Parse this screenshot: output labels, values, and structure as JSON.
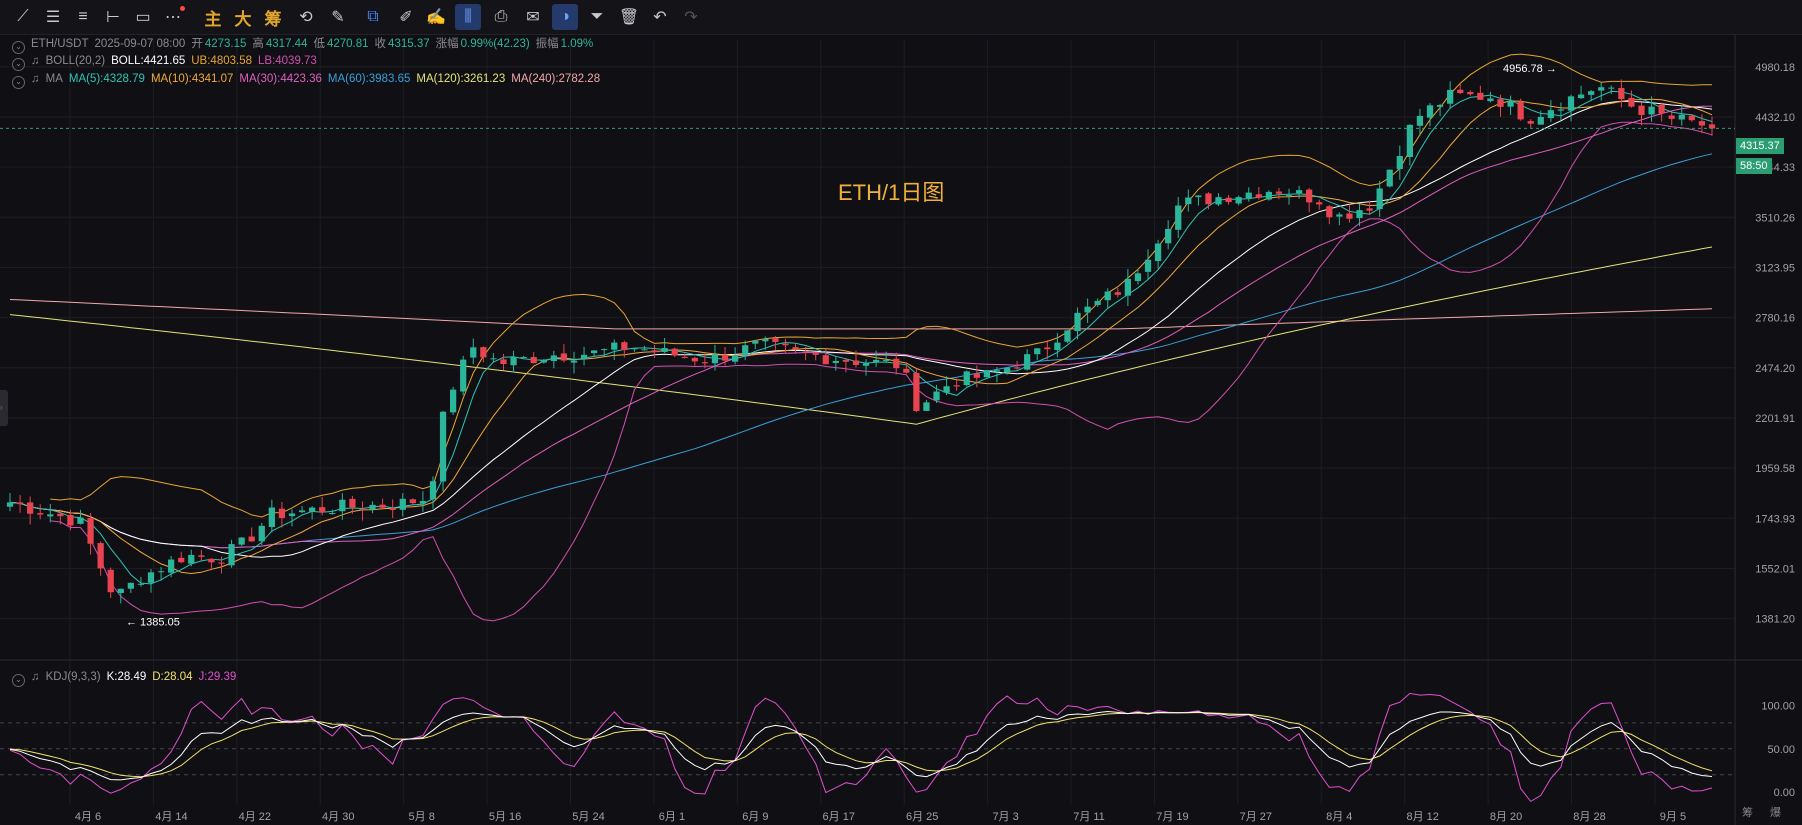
{
  "toolbar": {
    "tools": [
      {
        "name": "trendline-icon",
        "glyph": "⟋"
      },
      {
        "name": "horizontal-lines-icon",
        "glyph": "☰"
      },
      {
        "name": "parallel-lines-icon",
        "glyph": "≡"
      },
      {
        "name": "horizontal-ray-icon",
        "glyph": "⊢"
      },
      {
        "name": "rectangle-icon",
        "glyph": "▭"
      },
      {
        "name": "more-icon",
        "glyph": "⋯"
      },
      {
        "name": "main-chart-toggle",
        "glyph": "主",
        "cn": true
      },
      {
        "name": "large-toggle",
        "glyph": "大",
        "cn": true
      },
      {
        "name": "chips-toggle",
        "glyph": "筹",
        "cn": true
      },
      {
        "name": "strategy-icon",
        "glyph": "⟲"
      },
      {
        "name": "draw-settings-icon",
        "glyph": "✎"
      },
      {
        "name": "copy-icon",
        "glyph": "⧉",
        "active": true
      },
      {
        "name": "ruler-icon",
        "glyph": "✐"
      },
      {
        "name": "pen-icon",
        "glyph": "✍"
      },
      {
        "name": "compare-icon",
        "glyph": "⫼",
        "selected": true
      },
      {
        "name": "lock-icon",
        "glyph": "⎙"
      },
      {
        "name": "note-icon",
        "glyph": "✉"
      },
      {
        "name": "magnet-icon",
        "glyph": "◑",
        "selected": true
      },
      {
        "name": "filter-icon",
        "glyph": "⏷"
      },
      {
        "name": "delete-icon",
        "glyph": "🗑"
      },
      {
        "name": "undo-icon",
        "glyph": "↶"
      },
      {
        "name": "redo-icon",
        "glyph": "↷",
        "dim": true
      }
    ]
  },
  "ohlc": {
    "symbol": "ETH/USDT",
    "date": "2025-09-07 08:00",
    "open_label": "开",
    "open": "4273.15",
    "high_label": "高",
    "high": "4317.44",
    "low_label": "低",
    "low": "4270.81",
    "close_label": "收",
    "close": "4315.37",
    "change_label": "涨幅",
    "change": "0.99%(42.23)",
    "amp_label": "振幅",
    "amp": "1.09%"
  },
  "boll": {
    "name": "BOLL(20,2)",
    "mid": "BOLL:4421.65",
    "ub": "UB:4803.58",
    "lb": "LB:4039.73"
  },
  "ma": {
    "name": "MA",
    "ma5": "MA(5):4328.79",
    "ma10": "MA(10):4341.07",
    "ma30": "MA(30):4423.36",
    "ma60": "MA(60):3983.65",
    "ma120": "MA(120):3261.23",
    "ma240": "MA(240):2782.28"
  },
  "kdj": {
    "name": "KDJ(9,3,3)",
    "k": "K:28.49",
    "d": "D:28.04",
    "j": "J:29.39"
  },
  "watermark": "ETH/1日图",
  "current_price": "4315.37",
  "countdown": "58:50",
  "high_marker": "4956.78",
  "low_marker": "1385.05",
  "corner_labels": [
    "筹",
    "爆"
  ],
  "colors": {
    "up": "#2bb59a",
    "down": "#e8444f",
    "ma5": "#2ec4b6",
    "ma10": "#f0a93a",
    "ma30": "#e05fc0",
    "ma60": "#3a9fd8",
    "ma120": "#e3e37a",
    "ma240": "#f2a8a8",
    "boll_mid": "#ffffff",
    "boll_band": "#e8a530",
    "boll_lb": "#d04fb0",
    "kdj_k": "#ffffff",
    "kdj_d": "#f2e26a",
    "kdj_j": "#e04fd0"
  },
  "chart_data": {
    "type": "candlestick",
    "title": "ETH/1日图",
    "x_ticks": [
      "4月 6",
      "4月 14",
      "4月 22",
      "4月 30",
      "5月 8",
      "5月 16",
      "5月 24",
      "6月 1",
      "6月 9",
      "6月 17",
      "6月 25",
      "7月 3",
      "7月 11",
      "7月 19",
      "7月 27",
      "8月 4",
      "8月 12",
      "8月 20",
      "8月 28",
      "9月 5"
    ],
    "y_ticks": [
      "4980.18",
      "4432.10",
      "3944.33",
      "3510.26",
      "3123.95",
      "2780.16",
      "2474.20",
      "2201.91",
      "1959.58",
      "1743.93",
      "1552.01",
      "1381.20"
    ],
    "y_range": [
      1290,
      5300
    ],
    "kdj_ticks": [
      "100.00",
      "50.00",
      "0.00"
    ],
    "kdj_range": [
      -15,
      118
    ],
    "series_ranges": {
      "high": 4956.78,
      "low": 1385.05,
      "last_close": 4315.37
    }
  }
}
